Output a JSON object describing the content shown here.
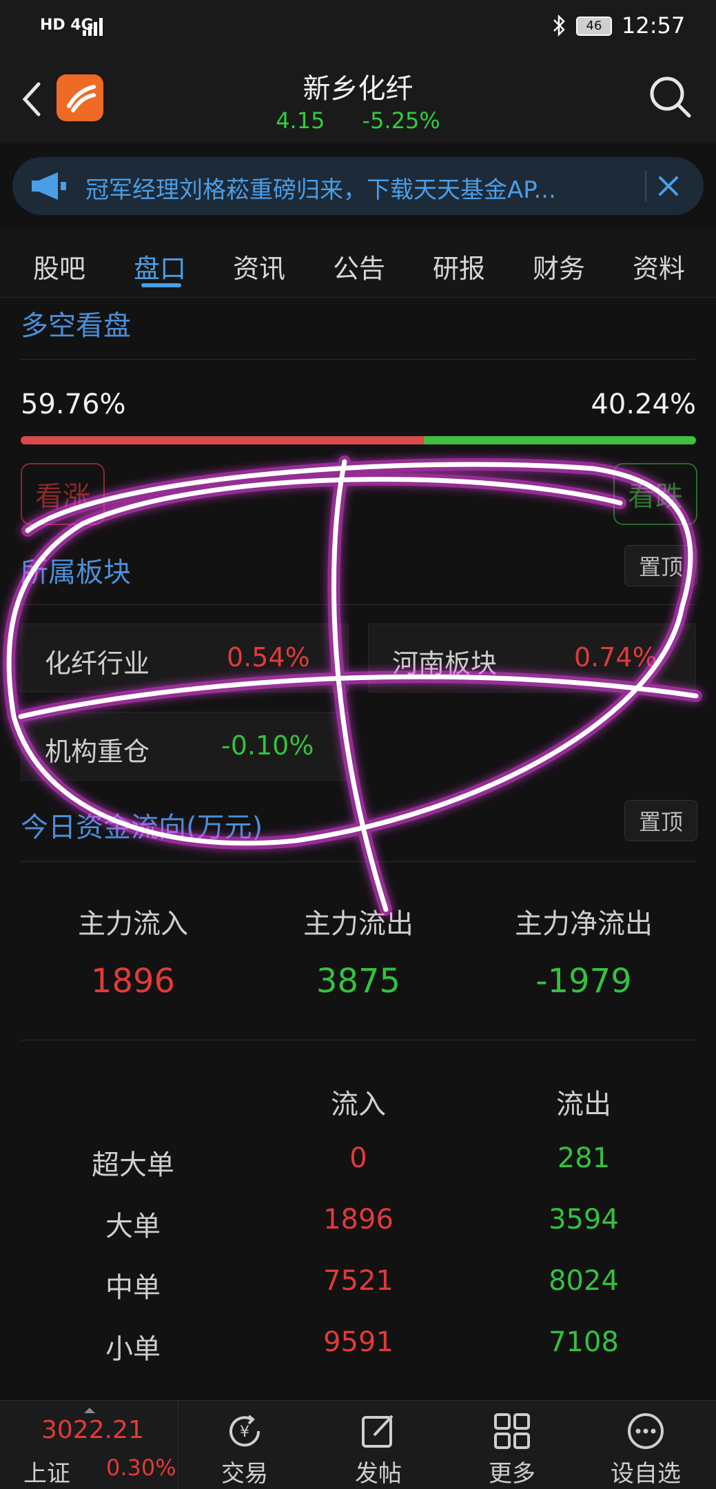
{
  "status_bar": {
    "network": "HD 4G",
    "battery": "46",
    "time": "12:57"
  },
  "header": {
    "stock_name": "新乡化纤",
    "price": "4.15",
    "change_pct": "-5.25%"
  },
  "banner": {
    "text": "冠军经理刘格菘重磅归来，下载天天基金AP..."
  },
  "tabs": [
    {
      "label": "股吧"
    },
    {
      "label": "盘口"
    },
    {
      "label": "资讯"
    },
    {
      "label": "公告"
    },
    {
      "label": "研报"
    },
    {
      "label": "财务"
    },
    {
      "label": "资料"
    }
  ],
  "sentiment": {
    "title": "多空看盘",
    "bull_pct": "59.76%",
    "bear_pct": "40.24%",
    "bull_button": "看涨",
    "bear_button": "看跌"
  },
  "sectors": {
    "title": "所属板块",
    "pin_label": "置顶",
    "items": [
      {
        "name": "化纤行业",
        "change": "0.54%"
      },
      {
        "name": "河南板块",
        "change": "0.74%"
      },
      {
        "name": "机构重仓",
        "change": "-0.10%"
      }
    ]
  },
  "capital_flow": {
    "title": "今日资金流向(万元)",
    "pin_label": "置顶",
    "summary": [
      {
        "label": "主力流入",
        "value": "1896"
      },
      {
        "label": "主力流出",
        "value": "3875"
      },
      {
        "label": "主力净流出",
        "value": "-1979"
      }
    ],
    "table_headers": {
      "in": "流入",
      "out": "流出"
    },
    "rows": [
      {
        "label": "超大单",
        "in": "0",
        "out": "281"
      },
      {
        "label": "大单",
        "in": "1896",
        "out": "3594"
      },
      {
        "label": "中单",
        "in": "7521",
        "out": "8024"
      },
      {
        "label": "小单",
        "in": "9591",
        "out": "7108"
      }
    ]
  },
  "bottom_bar": {
    "index_value": "3022.21",
    "index_name": "上证",
    "index_change": "0.30%",
    "nav": [
      {
        "label": "交易",
        "icon": "trade-icon"
      },
      {
        "label": "发帖",
        "icon": "compose-icon"
      },
      {
        "label": "更多",
        "icon": "grid-icon"
      },
      {
        "label": "设自选",
        "icon": "more-icon"
      }
    ]
  },
  "colors": {
    "up": "#e33a3a",
    "down": "#33c23f",
    "accent": "#4a9ee6",
    "highlight_scribble": "#ff3cff"
  }
}
